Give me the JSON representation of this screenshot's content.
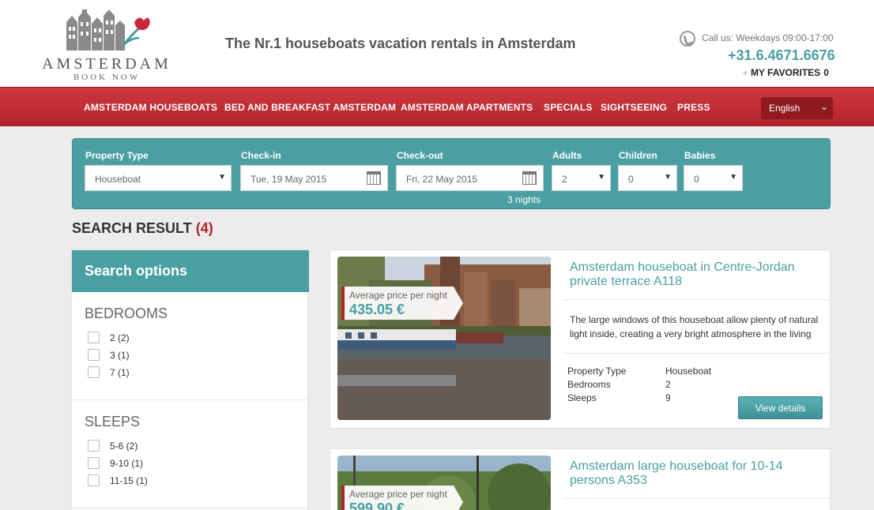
{
  "header": {
    "logo_title": "AMSTERDAM",
    "logo_sub": "BOOK NOW",
    "tagline": "The Nr.1 houseboats vacation rentals in Amsterdam",
    "call_text": "Call us: Weekdays 09:00-17:00",
    "phone": "+31.6.4671.6676",
    "favorites_label": "MY FAVORITES",
    "favorites_count": "0"
  },
  "nav": {
    "items": [
      "AMSTERDAM HOUSEBOATS",
      "BED AND BREAKFAST AMSTERDAM",
      "AMSTERDAM APARTMENTS",
      "SPECIALS",
      "SIGHTSEEING",
      "PRESS"
    ],
    "language": "English"
  },
  "search": {
    "property_type_label": "Property Type",
    "property_type_value": "Houseboat",
    "checkin_label": "Check-in",
    "checkin_value": "Tue, 19 May 2015",
    "checkout_label": "Check-out",
    "checkout_value": "Fri, 22 May 2015",
    "adults_label": "Adults",
    "adults_value": "2",
    "children_label": "Children",
    "children_value": "0",
    "babies_label": "Babies",
    "babies_value": "0",
    "nights": "3 nights"
  },
  "results": {
    "title": "SEARCH RESULT",
    "count": "(4)"
  },
  "sidebar": {
    "title": "Search options",
    "bedrooms_title": "BEDROOMS",
    "bedrooms": [
      "2 (2)",
      "3 (1)",
      "7 (1)"
    ],
    "sleeps_title": "SLEEPS",
    "sleeps": [
      "5-6 (2)",
      "9-10 (1)",
      "11-15 (1)"
    ]
  },
  "listings": [
    {
      "price_label": "Average price per night",
      "price": "435.05 €",
      "title": "Amsterdam houseboat in Centre-Jordan private terrace A118",
      "description": "The large windows of this houseboat allow plenty of natural light inside, creating a very bright atmosphere in the living",
      "spec_labels": [
        "Property Type",
        "Bedrooms",
        "Sleeps"
      ],
      "spec_values": [
        "Houseboat",
        "2",
        "9"
      ],
      "button": "View details"
    },
    {
      "price_label": "Average price per night",
      "price": "599.90 €",
      "title": "Amsterdam large houseboat for 10-14 persons A353"
    }
  ],
  "colors": {
    "teal": "#4a9fa3",
    "red": "#b0232b"
  }
}
